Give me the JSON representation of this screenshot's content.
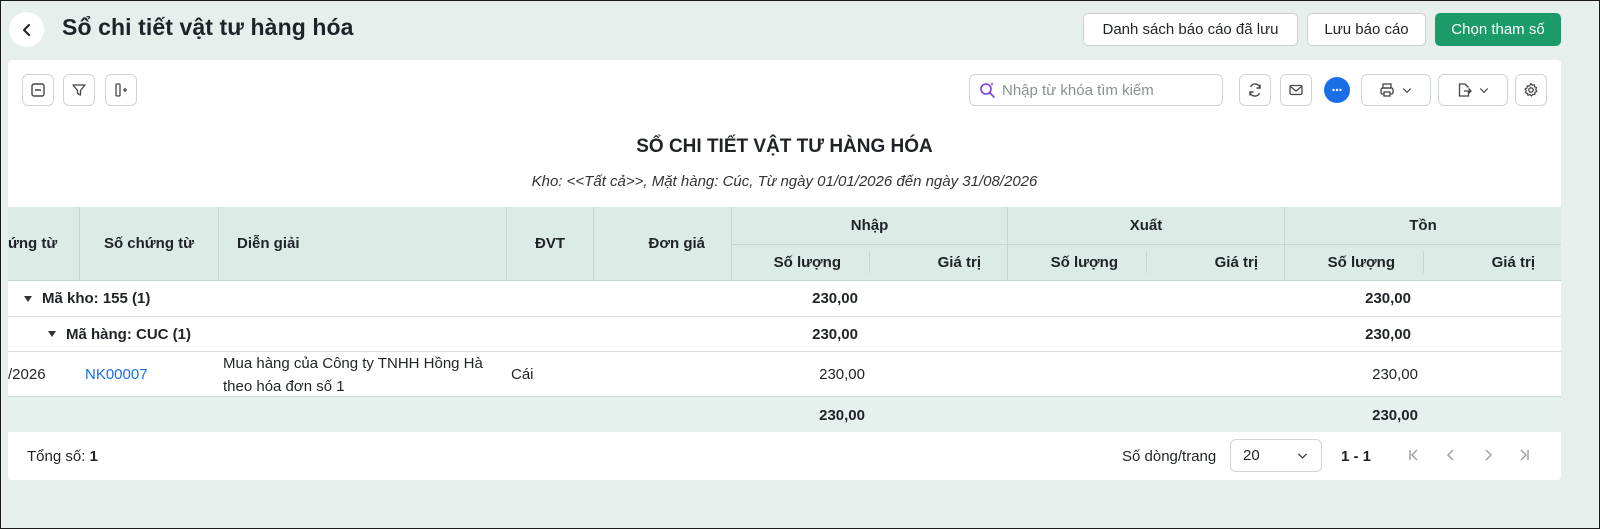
{
  "header": {
    "title": "Sổ chi tiết vật tư hàng hóa",
    "btn_saved_list": "Danh sách báo cáo đã lưu",
    "btn_save": "Lưu báo cáo",
    "btn_params": "Chọn tham số"
  },
  "toolbar": {
    "search_placeholder": "Nhập từ khóa tìm kiếm"
  },
  "report": {
    "title": "SỔ CHI TIẾT VẬT TƯ HÀNG HÓA",
    "subtitle": "Kho: <<Tất cả>>, Mặt hàng: Cúc, Từ ngày 01/01/2026 đến ngày 31/08/2026"
  },
  "table": {
    "headers": {
      "date": "ứng từ",
      "doc_no": "Số chứng từ",
      "desc": "Diễn giải",
      "unit": "ĐVT",
      "price": "Đơn giá",
      "in": "Nhập",
      "out": "Xuất",
      "stock": "Tồn",
      "qty": "Số lượng",
      "value": "Giá trị"
    },
    "group_kho": {
      "label": "Mã kho: 155  (1)",
      "in_qty": "230,00",
      "stock_qty": "230,00"
    },
    "group_hang": {
      "label": "Mã hàng: CUC  (1)",
      "in_qty": "230,00",
      "stock_qty": "230,00"
    },
    "row": {
      "date": "/2026",
      "doc_no": "NK00007",
      "desc_line1": "Mua hàng của Công ty TNHH Hồng Hà",
      "desc_line2": "theo hóa đơn số 1",
      "unit": "Cái",
      "in_qty": "230,00",
      "stock_qty": "230,00"
    },
    "total": {
      "in_qty": "230,00",
      "stock_qty": "230,00"
    }
  },
  "pager": {
    "total_label": "Tổng số:",
    "total_value": "1",
    "rows_label": "Số dòng/trang",
    "rows_value": "20",
    "range": "1 - 1"
  },
  "colors": {
    "primary": "#1b9b6a",
    "link": "#1a6fe8",
    "header_bg": "#dcebe5"
  }
}
